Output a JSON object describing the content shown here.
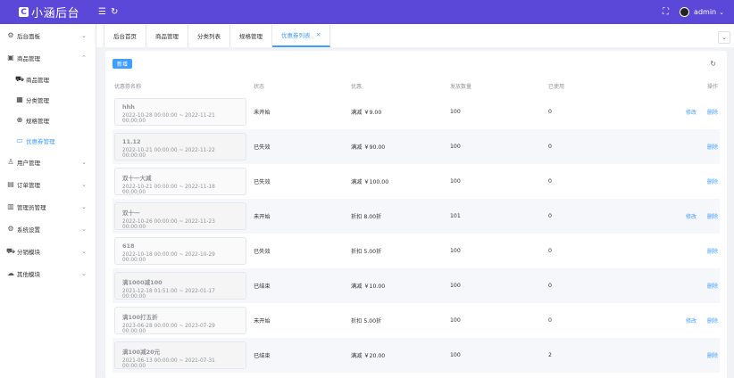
{
  "header": {
    "logo_mark": "C",
    "title": "小涵后台",
    "user": "admin"
  },
  "sidebar": {
    "items": [
      {
        "label": "后台面板",
        "icon": "gear-icon",
        "arrow": "⌄"
      },
      {
        "label": "商品管理",
        "icon": "bag-icon",
        "arrow": "⌃"
      },
      {
        "label": "用户管理",
        "icon": "user-icon",
        "arrow": "⌄"
      },
      {
        "label": "订单管理",
        "icon": "order-icon",
        "arrow": "⌄"
      },
      {
        "label": "管理员管理",
        "icon": "admin-icon",
        "arrow": "⌄"
      },
      {
        "label": "系统设置",
        "icon": "settings-icon",
        "arrow": "⌄"
      },
      {
        "label": "分销模块",
        "icon": "cart-icon",
        "arrow": "⌄"
      },
      {
        "label": "其他模块",
        "icon": "cloud-icon",
        "arrow": "⌄"
      }
    ],
    "sub_items": [
      {
        "label": "商品管理",
        "icon": "cart-icon"
      },
      {
        "label": "分类管理",
        "icon": "grid-icon"
      },
      {
        "label": "规格管理",
        "icon": "target-icon"
      },
      {
        "label": "优惠券管理",
        "icon": "coupon-icon"
      }
    ]
  },
  "tabs": [
    {
      "label": "后台首页"
    },
    {
      "label": "商品管理"
    },
    {
      "label": "分类列表"
    },
    {
      "label": "规格管理"
    },
    {
      "label": "优惠券列表",
      "close": "×"
    }
  ],
  "toolbar": {
    "add_label": "新增"
  },
  "table": {
    "headers": [
      "优惠券名称",
      "状态",
      "优惠",
      "发放数量",
      "已使用",
      "操作"
    ],
    "edit_label": "修改",
    "delete_label": "删除",
    "rows": [
      {
        "name": "hhh",
        "date": "2022-10-28 00:00:00 ~ 2022-11-21 00:00:00",
        "status": "未开始",
        "discount": "满减 ￥9.00",
        "total": "100",
        "used": "0",
        "editable": true
      },
      {
        "name": "11.12",
        "date": "2022-10-21 00:00:00 ~ 2022-11-22 00:00:00",
        "status": "已失效",
        "discount": "满减 ￥90.00",
        "total": "100",
        "used": "0",
        "editable": false
      },
      {
        "name": "双十一大减",
        "date": "2022-10-21 00:00:00 ~ 2022-11-18 00:00:00",
        "status": "已失效",
        "discount": "满减 ￥100.00",
        "total": "100",
        "used": "0",
        "editable": false
      },
      {
        "name": "双十一",
        "date": "2022-10-26 00:00:00 ~ 2022-11-23 00:00:00",
        "status": "未开始",
        "discount": "折扣 8.00折",
        "total": "101",
        "used": "0",
        "editable": true
      },
      {
        "name": "618",
        "date": "2022-10-18 00:00:00 ~ 2022-10-29 00:00:00",
        "status": "已失效",
        "discount": "折扣 5.00折",
        "total": "100",
        "used": "0",
        "editable": false
      },
      {
        "name": "满1000减100",
        "date": "2021-12-18 01:51:00 ~ 2022-01-17 00:00:00",
        "status": "已结束",
        "discount": "满减 ￥10.00",
        "total": "100",
        "used": "0",
        "editable": false
      },
      {
        "name": "满100打五折",
        "date": "2023-06-28 00:00:00 ~ 2023-07-29 00:00:00",
        "status": "未开始",
        "discount": "折扣 5.00折",
        "total": "100",
        "used": "0",
        "editable": true
      },
      {
        "name": "满100减20元",
        "date": "2021-06-13 00:00:00 ~ 2021-07-31 00:00:00",
        "status": "已结束",
        "discount": "满减 ￥20.00",
        "total": "100",
        "used": "2",
        "editable": false
      }
    ]
  }
}
